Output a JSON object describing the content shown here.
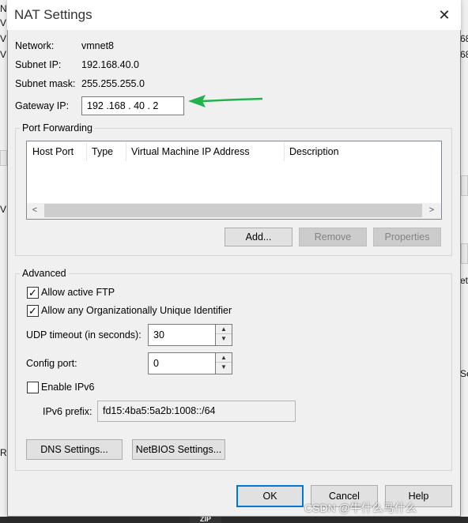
{
  "dialog": {
    "title": "NAT Settings",
    "close_icon": "close-icon"
  },
  "info": {
    "network_label": "Network:",
    "network_value": "vmnet8",
    "subnet_ip_label": "Subnet IP:",
    "subnet_ip_value": "192.168.40.0",
    "subnet_mask_label": "Subnet mask:",
    "subnet_mask_value": "255.255.255.0",
    "gateway_label": "Gateway IP:",
    "gateway_value": "192 .168 . 40 . 2"
  },
  "annotation": {
    "arrow_color": "#22b14c"
  },
  "port_forwarding": {
    "title": "Port Forwarding",
    "columns": [
      "Host Port",
      "Type",
      "Virtual Machine IP Address",
      "Description"
    ],
    "rows": [],
    "add_label": "Add...",
    "remove_label": "Remove",
    "properties_label": "Properties"
  },
  "advanced": {
    "title": "Advanced",
    "allow_ftp_label": "Allow active FTP",
    "allow_ftp_checked": true,
    "allow_oui_label": "Allow any Organizationally Unique Identifier",
    "allow_oui_checked": true,
    "udp_timeout_label": "UDP timeout (in seconds):",
    "udp_timeout_value": "30",
    "config_port_label": "Config port:",
    "config_port_value": "0",
    "enable_ipv6_label": "Enable IPv6",
    "enable_ipv6_checked": false,
    "ipv6_prefix_label": "IPv6 prefix:",
    "ipv6_prefix_value": "fd15:4ba5:5a2b:1008::/64"
  },
  "settings_buttons": {
    "dns_label": "DNS Settings...",
    "netbios_label": "NetBIOS Settings..."
  },
  "footer": {
    "ok_label": "OK",
    "cancel_label": "Cancel",
    "help_label": "Help"
  },
  "background": {
    "left_fragments": [
      "N",
      "V",
      "V",
      "V",
      "V",
      "Re"
    ],
    "right_fragments": [
      "68",
      "68",
      "et",
      "Se"
    ],
    "taskbar_zip": "ZIP"
  },
  "watermark": "CSDN @牛什么马什么",
  "colors": {
    "accent": "#0078d7",
    "arrow": "#22b14c"
  }
}
